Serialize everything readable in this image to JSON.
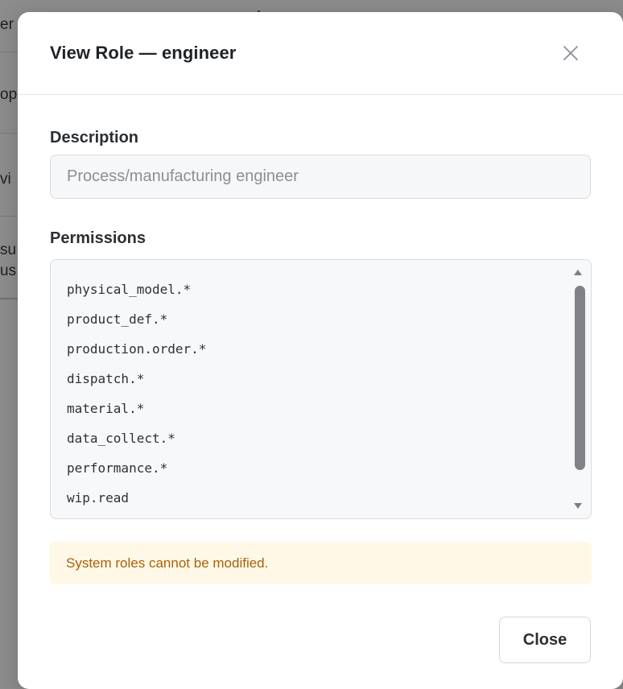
{
  "background": {
    "fragments": [
      "er",
      "op",
      "vi",
      "su",
      "us"
    ]
  },
  "modal": {
    "title": "View Role — engineer",
    "close_icon": "close-icon",
    "description": {
      "label": "Description",
      "placeholder": "Process/manufacturing engineer"
    },
    "permissions": {
      "label": "Permissions",
      "items": [
        "physical_model.*",
        "product_def.*",
        "production.order.*",
        "dispatch.*",
        "material.*",
        "data_collect.*",
        "performance.*",
        "wip.read"
      ]
    },
    "notice": "System roles cannot be modified.",
    "close_button": "Close"
  },
  "colors": {
    "notice_bg": "#fff8e6",
    "notice_text": "#a9600a",
    "overlay": "#8c8c8c"
  }
}
